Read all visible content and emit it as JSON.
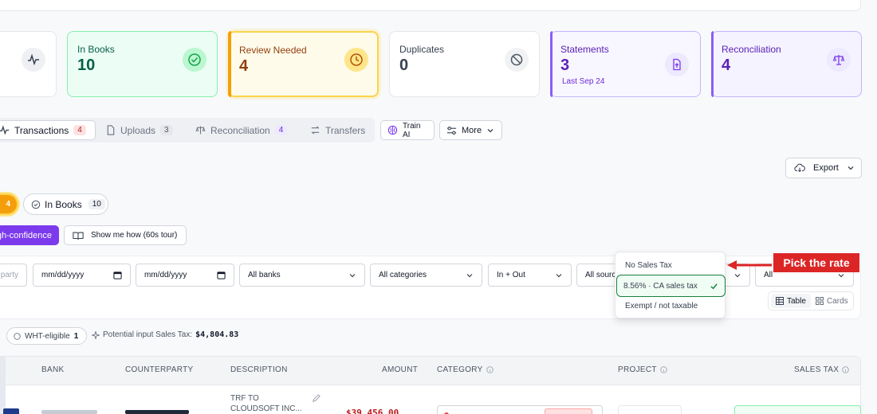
{
  "cards": {
    "in_books": {
      "label": "In Books",
      "value": "10"
    },
    "review": {
      "label": "Review Needed",
      "value": "4"
    },
    "duplicates": {
      "label": "Duplicates",
      "value": "0"
    },
    "statements": {
      "label": "Statements",
      "value": "3",
      "sub": "Last Sep 24"
    },
    "reconciliation": {
      "label": "Reconciliation",
      "value": "4"
    }
  },
  "tabs": [
    {
      "label": "Transactions",
      "count": "4"
    },
    {
      "label": "Uploads",
      "count": "3"
    },
    {
      "label": "Reconciliation",
      "count": "4"
    },
    {
      "label": "Transfers"
    }
  ],
  "toolbar": {
    "train_ai": "Train AI",
    "more": "More",
    "export": "Export"
  },
  "chips": {
    "review_count": "4",
    "in_books_label": "In Books",
    "in_books_count": "10"
  },
  "actions": {
    "high_conf": "gh-confidence",
    "tour": "Show me how (60s tour)"
  },
  "filters": {
    "party": "party",
    "date_from": "mm/dd/yyyy",
    "date_to": "mm/dd/yyyy",
    "banks": "All banks",
    "categories": "All categories",
    "direction": "In + Out",
    "sources": "All sourc",
    "last": "All"
  },
  "view_toggle": {
    "table": "Table",
    "cards": "Cards"
  },
  "dropdown": {
    "options": [
      "No Sales Tax",
      "8.56% · CA sales tax",
      "Exempt / not taxable"
    ],
    "selected_index": 1
  },
  "callout": "Pick the rate",
  "summary": {
    "wht_label": "WHT-eligible",
    "wht_count": "1",
    "potential_label": "Potential input Sales Tax:",
    "potential_value": "$4,804.83"
  },
  "columns": [
    "BANK",
    "COUNTERPARTY",
    "DESCRIPTION",
    "AMOUNT",
    "CATEGORY",
    "PROJECT",
    "SALES TAX"
  ],
  "row": {
    "desc_line1": "TRF TO",
    "desc_line2": "CLOUDSOFT INC...",
    "amount": "$39,456.00"
  },
  "colors": {
    "accent_purple": "#7c3aed",
    "green": "#16a34a",
    "amber": "#d97706",
    "red_callout": "#dc2626"
  }
}
